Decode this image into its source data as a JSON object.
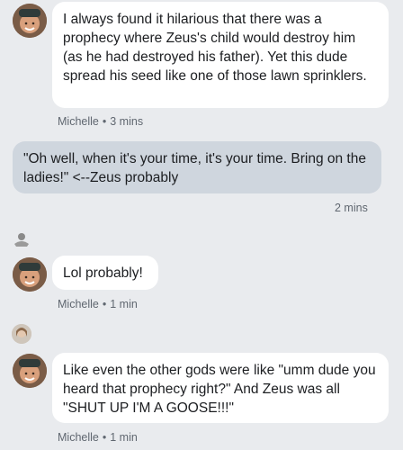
{
  "messages": [
    {
      "sender": "Michelle",
      "text": "I always found it hilarious that there was a prophecy where Zeus's child would destroy him (as he had destroyed his father). Yet this dude spread his seed like one of those lawn sprinklers.",
      "time": "3 mins"
    },
    {
      "sender": "me",
      "text": "\"Oh well, when it's your time, it's your time. Bring on the ladies!\" <--Zeus probably",
      "time": "2 mins"
    },
    {
      "sender": "Michelle",
      "text": "Lol probably!",
      "time": "1 min"
    },
    {
      "sender": "Michelle",
      "text": "Like even the other gods were like \"umm dude you heard that prophecy right?\" And Zeus was all \"SHUT UP I'M A GOOSE!!!\"",
      "time": "1 min"
    }
  ],
  "separator": "•",
  "colors": {
    "background": "#e9ebee",
    "incoming_bubble": "#ffffff",
    "outgoing_bubble": "#cfd6de",
    "meta_text": "#606770"
  }
}
